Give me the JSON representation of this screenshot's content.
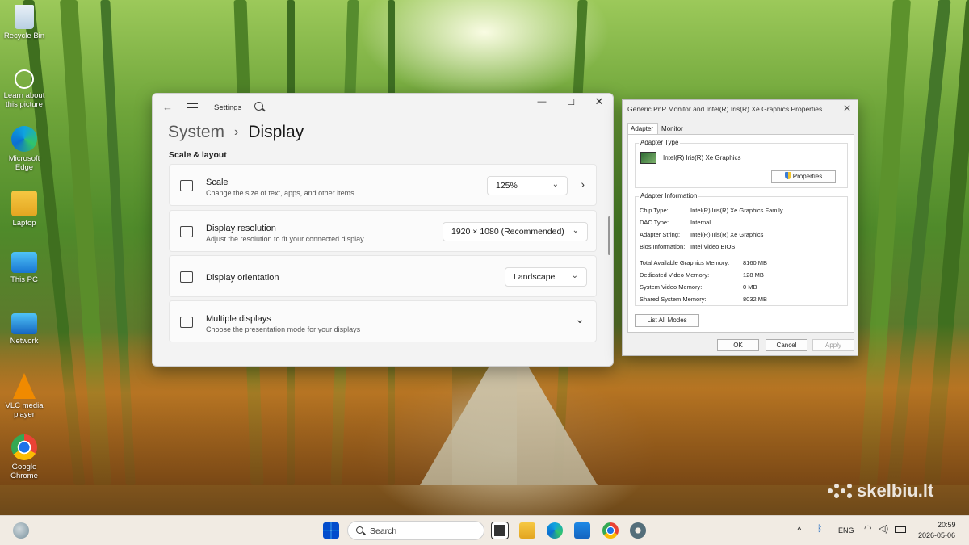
{
  "desktop": {
    "icons": [
      {
        "label": "Recycle Bin",
        "icon": "recycle-bin-icon"
      },
      {
        "label": "Learn about this picture",
        "icon": "learn-picture-icon"
      },
      {
        "label": "Microsoft Edge",
        "icon": "edge-icon"
      },
      {
        "label": "Laptop",
        "icon": "user-folder-icon"
      },
      {
        "label": "This PC",
        "icon": "monitor-icon"
      },
      {
        "label": "Network",
        "icon": "network-icon"
      },
      {
        "label": "VLC media player",
        "icon": "vlc-icon"
      },
      {
        "label": "Google Chrome",
        "icon": "chrome-icon"
      }
    ]
  },
  "settings": {
    "app_title": "Settings",
    "breadcrumb_parent": "System",
    "breadcrumb_separator": "›",
    "breadcrumb_current": "Display",
    "section": "Scale & layout",
    "cards": {
      "scale": {
        "title": "Scale",
        "subtitle": "Change the size of text, apps, and other items",
        "value": "125%"
      },
      "resolution": {
        "title": "Display resolution",
        "subtitle": "Adjust the resolution to fit your connected display",
        "value": "1920 × 1080 (Recommended)"
      },
      "orientation": {
        "title": "Display orientation",
        "value": "Landscape"
      },
      "multiple": {
        "title": "Multiple displays",
        "subtitle": "Choose the presentation mode for your displays"
      }
    }
  },
  "properties": {
    "title": "Generic PnP Monitor and Intel(R) Iris(R) Xe Graphics Properties",
    "tabs": [
      "Adapter",
      "Monitor"
    ],
    "adapter_type_label": "Adapter Type",
    "adapter_name": "Intel(R) Iris(R) Xe Graphics",
    "properties_button": "Properties",
    "adapter_info_label": "Adapter Information",
    "info": [
      {
        "key": "Chip Type:",
        "value": "Intel(R) Iris(R) Xe Graphics Family"
      },
      {
        "key": "DAC Type:",
        "value": "Internal"
      },
      {
        "key": "Adapter String:",
        "value": "Intel(R) Iris(R) Xe Graphics"
      },
      {
        "key": "Bios Information:",
        "value": "Intel Video BIOS"
      }
    ],
    "memory": [
      {
        "key": "Total Available Graphics Memory:",
        "value": "8160 MB"
      },
      {
        "key": "Dedicated Video Memory:",
        "value": "128 MB"
      },
      {
        "key": "System Video Memory:",
        "value": "0 MB"
      },
      {
        "key": "Shared System Memory:",
        "value": "8032 MB"
      }
    ],
    "list_modes_button": "List All Modes",
    "ok": "OK",
    "cancel": "Cancel",
    "apply": "Apply"
  },
  "watermark": "skelbiu.lt",
  "taskbar": {
    "search_placeholder": "Search",
    "language": "ENG",
    "time": "20:59",
    "date": "2026-05-06"
  }
}
